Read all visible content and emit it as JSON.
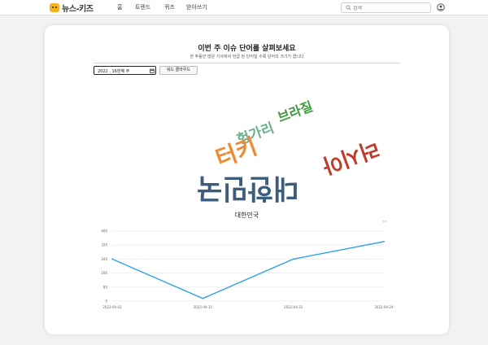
{
  "nav": {
    "logo_text": "뉴스-키즈",
    "links": [
      "홈",
      "트렌드",
      "퀴즈",
      "받아쓰기"
    ],
    "search_placeholder": "검색"
  },
  "card": {
    "title": "이번 주 이슈 단어를 살펴보세요",
    "subtitle": "한 주동안 많은 기사에서 언급 된 단어일 수록 단어의 크기가 큽니다",
    "date_value": "2022 . 16번째 주",
    "wordcloud_button": "워드 클라우드"
  },
  "wordcloud": [
    {
      "text": "브라질",
      "color": "#3f9a3f"
    },
    {
      "text": "헝가리",
      "color": "#6bb08e"
    },
    {
      "text": "터키",
      "color": "#f08a33"
    },
    {
      "text": "러시아",
      "color": "#bf3b2c"
    },
    {
      "text": "대한민국",
      "color": "#3d5d7e"
    }
  ],
  "chart_data": {
    "type": "line",
    "title": "대한민국",
    "legend_label": "???",
    "x": [
      "2022-04-02",
      "2022-04-15",
      "2022-04-22",
      "2022-04-24"
    ],
    "series": [
      {
        "values": [
          240,
          15,
          240,
          340
        ]
      }
    ],
    "yticks": [
      0,
      80,
      160,
      240,
      320,
      400
    ],
    "ylim": [
      0,
      400
    ],
    "color": "#2aa0e6",
    "grid": true
  }
}
